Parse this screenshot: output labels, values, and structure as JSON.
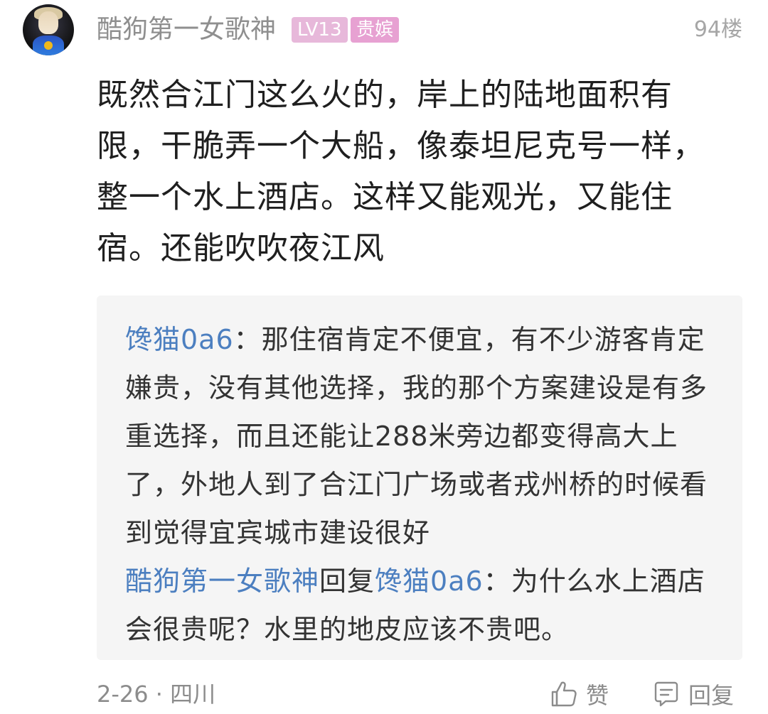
{
  "author": {
    "name": "酷狗第一女歌神",
    "level_badge": "LV13",
    "title_badge": "贵嫔",
    "avatar_icon": "user-avatar"
  },
  "floor": "94楼",
  "content": "既然合江门这么火的，岸上的陆地面积有限，干脆弄一个大船，像泰坦尼克号一样，整一个水上酒店。这样又能观光，又能住宿。还能吹吹夜江风",
  "replies": [
    {
      "from": "馋猫0a6",
      "separator": "：",
      "text": "那住宿肯定不便宜，有不少游客肯定嫌贵，没有其他选择，我的那个方案建设是有多重选择，而且还能让288米旁边都变得高大上了，外地人到了合江门广场或者戎州桥的时候看到觉得宜宾城市建设很好"
    },
    {
      "from": "酷狗第一女歌神",
      "reply_word": "回复",
      "to": "馋猫0a6",
      "separator": "：",
      "text": "为什么水上酒店会很贵呢？水里的地皮应该不贵吧。"
    }
  ],
  "meta": "2-26 · 四川",
  "actions": {
    "like_label": "赞",
    "like_icon": "thumbs-up-icon",
    "reply_label": "回复",
    "reply_icon": "comment-icon"
  },
  "colors": {
    "username": "#8f8f8f",
    "reply_name": "#4c7fc0",
    "level_badge": "#e7b8da",
    "title_badge": "#e7a1d2",
    "reply_bg": "#f5f5f5"
  }
}
